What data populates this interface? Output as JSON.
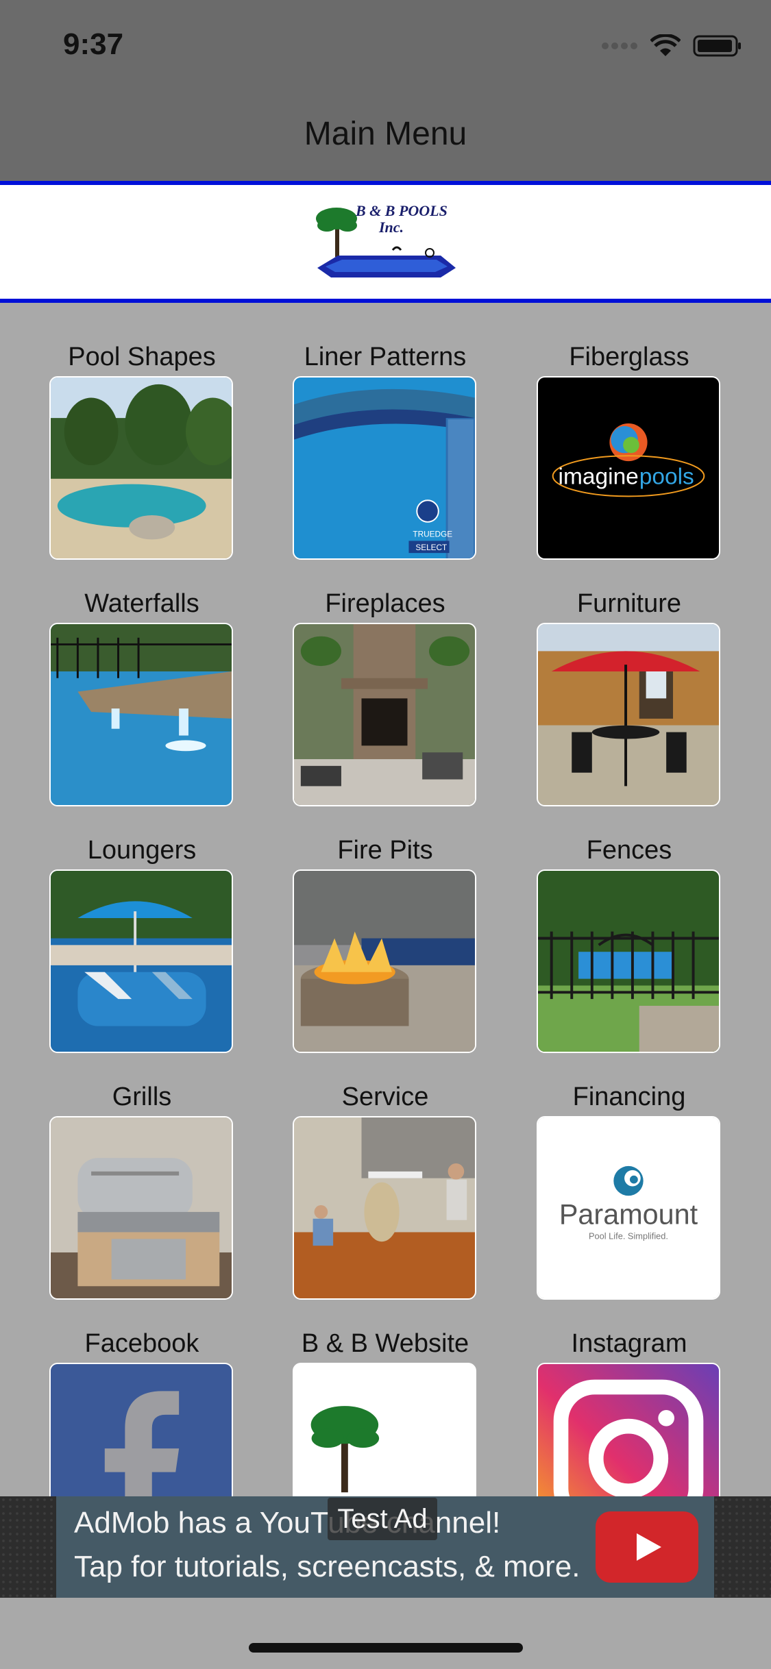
{
  "status": {
    "time": "9:37"
  },
  "nav": {
    "title": "Main Menu"
  },
  "logo": {
    "text_line1": "B & B POOLS",
    "text_line2": "Inc."
  },
  "menu": {
    "row1": [
      "Pool Shapes",
      "Liner Patterns",
      "Fiberglass"
    ],
    "row2": [
      "Waterfalls",
      "Fireplaces",
      "Furniture"
    ],
    "row3": [
      "Loungers",
      "Fire Pits",
      "Fences"
    ],
    "row4": [
      "Grills",
      "Service",
      "Financing"
    ],
    "row5": [
      "Facebook",
      "B & B Website",
      "Instagram"
    ]
  },
  "thumbs": {
    "liner_badge_top": "TRUEDGE",
    "liner_badge_bottom": "SELECT",
    "fiberglass_brand_1": "imagine",
    "fiberglass_brand_2": "pools",
    "financing_brand": "Paramount",
    "financing_tagline": "Pool Life. Simplified."
  },
  "ad": {
    "line1": "AdMob has a YouTube channel!",
    "line2": "Tap for tutorials, screencasts, & more.",
    "badge": "Test Ad"
  },
  "colors": {
    "nav_bg": "#6b6b6b",
    "page_bg": "#a9a9a9",
    "brand_blue": "#0010d8",
    "ad_bg": "#455a66",
    "youtube_red": "#d2262a"
  }
}
